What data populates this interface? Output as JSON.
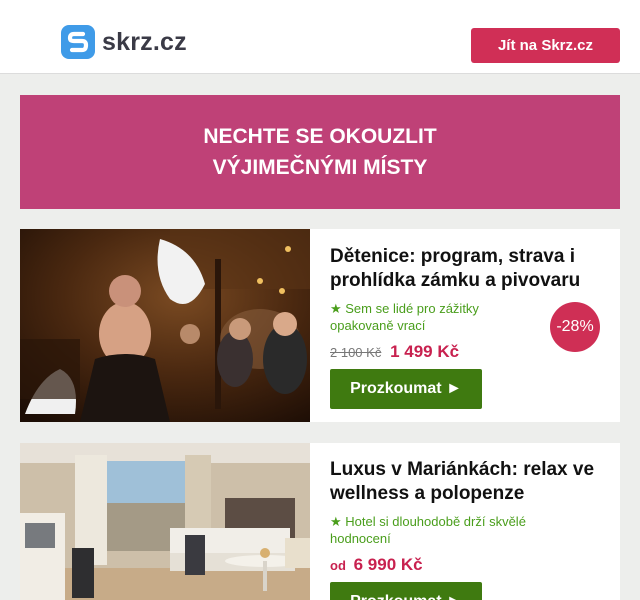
{
  "header": {
    "logo_text": "skrz.cz",
    "cta_label": "Jít na Skrz.cz"
  },
  "banner": {
    "line1": "NECHTE SE OKOUZLIT",
    "line2": "VÝJIMEČNÝMI MÍSTY"
  },
  "offers": [
    {
      "title": "Dětenice: program, strava i prohlídka zámku a pivovaru",
      "tagline": "★ Sem se lidé pro zážitky opakovaně vrací",
      "old_price": "2 100 Kč",
      "price": "1 499 Kč",
      "discount": "-28%",
      "button_label": "Prozkoumat ►"
    },
    {
      "title": "Luxus v Mariánkách: relax ve wellness a polopenze",
      "tagline": "★ Hotel si dlouhodobě drží skvělé hodnocení",
      "price_prefix": "od",
      "price": "6 990 Kč",
      "button_label": "Prozkoumat ►"
    }
  ],
  "colors": {
    "brand_blue": "#3f9be8",
    "cta_red": "#d02f56",
    "banner_pink": "#bf4177",
    "action_green": "#3f7a10",
    "tag_green": "#4a9e1c",
    "price_red": "#c8214f"
  }
}
